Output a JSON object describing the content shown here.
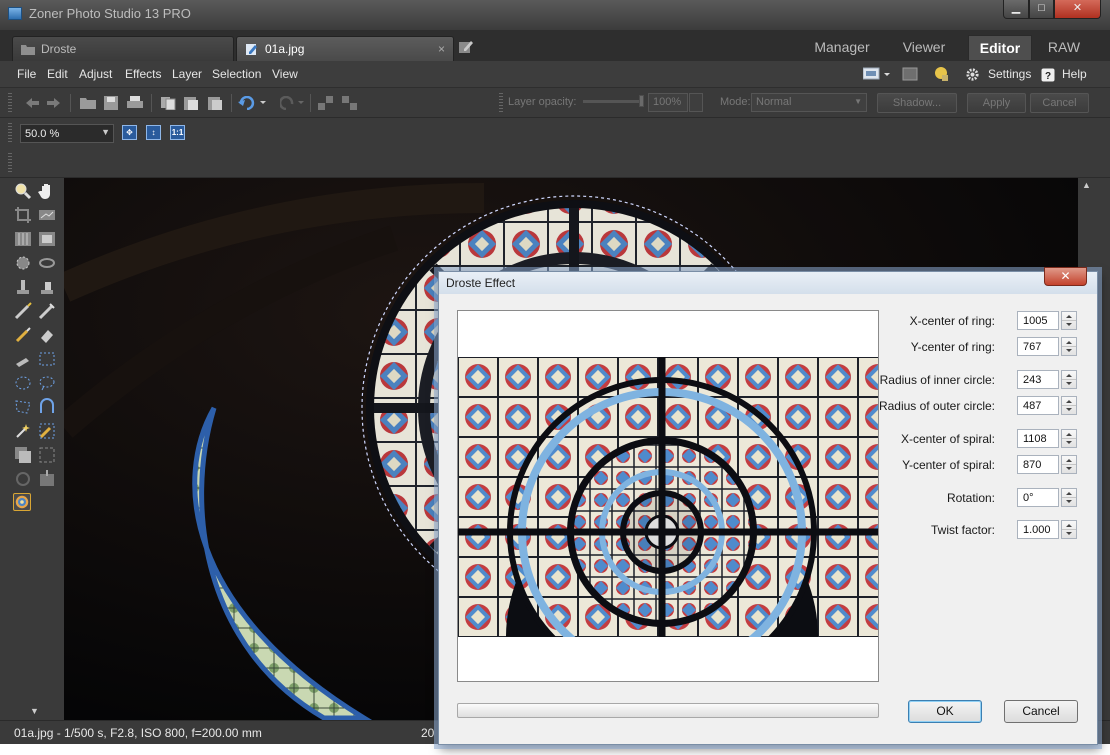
{
  "window": {
    "title": "Zoner Photo Studio 13 PRO"
  },
  "tabs": [
    {
      "label": "Droste"
    },
    {
      "label": "01a.jpg",
      "close": "×"
    }
  ],
  "modes": [
    "Manager",
    "Viewer",
    "Editor",
    "RAW"
  ],
  "active_mode": "Editor",
  "menu": [
    "File",
    "Edit",
    "Adjust",
    "Effects",
    "Layer",
    "Selection",
    "View"
  ],
  "menu_right": {
    "settings": "Settings",
    "help": "Help"
  },
  "toolbar": {
    "layer_opacity_label": "Layer opacity:",
    "layer_opacity_value": "100%",
    "mode_label": "Mode:",
    "mode_value": "Normal",
    "shadow_button": "Shadow...",
    "apply_button": "Apply",
    "cancel_button": "Cancel"
  },
  "zoom": {
    "value": "50.0 %",
    "fit": "",
    "height": "",
    "actual": "1:1"
  },
  "status": {
    "info": "01a.jpg - 1/500 s, F2.8, ISO 800, f=200.00 mm",
    "extra": "20"
  },
  "dialog": {
    "title": "Droste Effect",
    "close": "✕",
    "params": [
      {
        "label": "X-center of ring:",
        "value": "1005"
      },
      {
        "label": "Y-center of ring:",
        "value": "767"
      },
      {
        "label": "Radius of inner circle:",
        "value": "243"
      },
      {
        "label": "Radius of outer circle:",
        "value": "487"
      },
      {
        "label": "X-center of spiral:",
        "value": "1108"
      },
      {
        "label": "Y-center of spiral:",
        "value": "870"
      },
      {
        "label": "Rotation:",
        "value": "0°"
      },
      {
        "label": "Twist factor:",
        "value": "1.000"
      }
    ],
    "ok": "OK",
    "cancel": "Cancel"
  },
  "colors": {
    "accent": "#d9a634",
    "dialog_border": "#7a8ea6",
    "close_red": "#c3422c"
  }
}
